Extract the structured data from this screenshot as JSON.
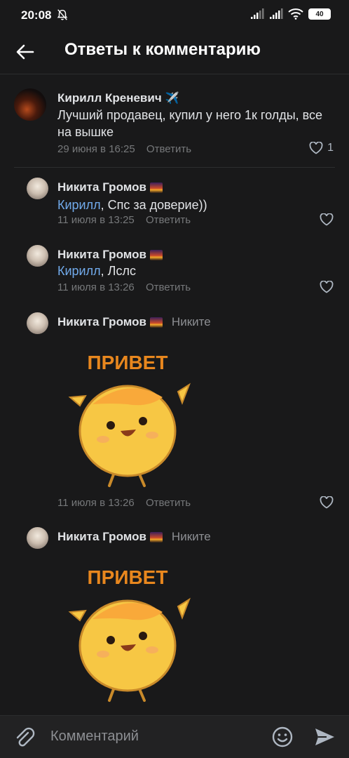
{
  "status_bar": {
    "time": "20:08",
    "battery": "40"
  },
  "header": {
    "title": "Ответы к комментарию"
  },
  "root_comment": {
    "author": "Кирилл Креневич",
    "author_emoji": "✈️",
    "text": "Лучший продавец, купил у него 1к голды, все на вышке",
    "time": "29 июня в 16:25",
    "reply_label": "Ответить",
    "likes": "1"
  },
  "replies": [
    {
      "author": "Никита Громов",
      "mention": "Кирилл",
      "text": ", Спс за доверие))",
      "time": "11 июля в 13:25",
      "reply_label": "Ответить"
    },
    {
      "author": "Никита Громов",
      "mention": "Кирилл",
      "text": ", Лслс",
      "time": "11 июля в 13:26",
      "reply_label": "Ответить"
    },
    {
      "author": "Никита Громов",
      "reply_to": "Никите",
      "sticker_text": "ПРИВЕТ",
      "time": "11 июля в 13:26",
      "reply_label": "Ответить"
    },
    {
      "author": "Никита Громов",
      "reply_to": "Никите",
      "sticker_text": "ПРИВЕТ"
    }
  ],
  "composer": {
    "placeholder": "Комментарий"
  },
  "colors": {
    "background": "#19191a",
    "accent": "#71aaeb",
    "secondary_text": "#76787a",
    "sticker_text": "#e8871e"
  }
}
